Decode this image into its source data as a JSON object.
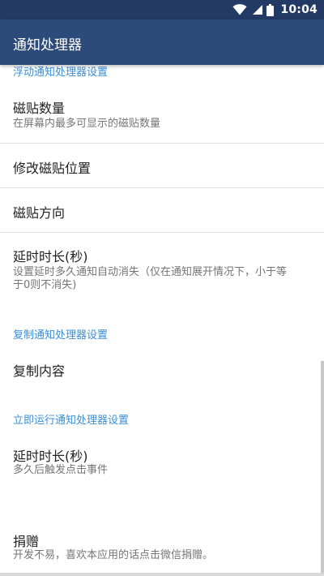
{
  "status_bar": {
    "time": "10:04",
    "icons": [
      "wifi-icon",
      "signal-icon",
      "battery-icon"
    ]
  },
  "app_bar": {
    "title": "通知处理器"
  },
  "sections": [
    {
      "header": "浮动通知处理器设置",
      "items": [
        {
          "title": "磁贴数量",
          "summary": "在屏幕内最多可显示的磁贴数量"
        },
        {
          "title": "修改磁贴位置"
        },
        {
          "title": "磁贴方向"
        },
        {
          "title": "延时时长(秒)",
          "summary_line1": "设置延时多久通知自动消失（仅在通知展开情况下，小于等",
          "summary_line2": "于0则不消失)"
        }
      ]
    },
    {
      "header": "复制通知处理器设置",
      "items": [
        {
          "title": "复制内容"
        }
      ]
    },
    {
      "header": "立即运行通知处理器设置",
      "items": [
        {
          "title": "延时时长(秒)",
          "summary": "多久后触发点击事件"
        }
      ]
    },
    {
      "items": [
        {
          "title": "捐赠",
          "summary": "开发不易，喜欢本应用的话点击微信捐赠。"
        }
      ]
    }
  ],
  "colors": {
    "status_bar": "#223a64",
    "app_bar": "#2d4b7a",
    "accent": "#3a8ed6",
    "title_text": "#212121",
    "summary_text": "#757575",
    "divider": "#e0e0e0"
  }
}
